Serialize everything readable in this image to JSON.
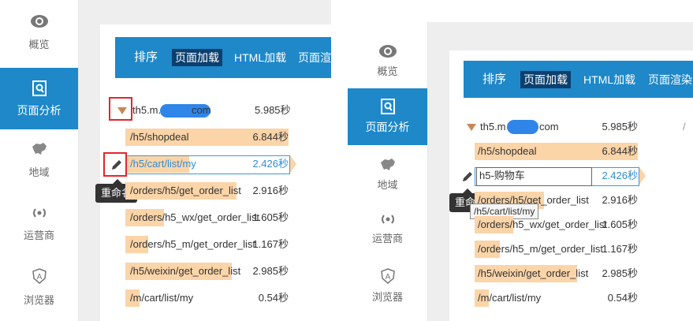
{
  "nav": {
    "overview": "概览",
    "page_analysis": "页面分析",
    "region": "地域",
    "carrier": "运营商",
    "browser": "浏览器"
  },
  "tabs": {
    "sort": "排序",
    "page_load": "页面加载",
    "html_load": "HTML加载",
    "page_render": "页面渲染"
  },
  "colors": {
    "accent": "#1e88c9",
    "active_tab": "#0b3f6e",
    "bar": "#fbd4a8",
    "highlight_time": "#2f8dd6",
    "annotation": "#e3262b"
  },
  "left": {
    "domain": {
      "prefix": "th5.m.",
      "suffix": "com",
      "time": "5.985秒"
    },
    "rows": [
      {
        "path": "/h5/shopdeal",
        "time": "6.844秒"
      },
      {
        "path": "/h5/cart/list/my",
        "time": "2.426秒"
      },
      {
        "path": "/orders/h5/get_order_list",
        "time": "2.916秒"
      },
      {
        "path": "/orders/h5_wx/get_order_list",
        "time": "1.605秒"
      },
      {
        "path": "/orders/h5_m/get_order_list",
        "time": "1.167秒"
      },
      {
        "path": "/h5/weixin/get_order_list",
        "time": "2.985秒"
      },
      {
        "path": "/m/cart/list/my",
        "time": "0.54秒"
      }
    ],
    "tooltip": "重命名"
  },
  "right": {
    "domain": {
      "prefix": "th5.m",
      "suffix": "com",
      "time": "5.985秒"
    },
    "rows": [
      {
        "path": "/h5/shopdeal",
        "time": "6.844秒"
      },
      {
        "path": "h5-购物车",
        "time": "2.426秒"
      },
      {
        "path": "/orders/h5/get_order_list",
        "time": "2.916秒"
      },
      {
        "path": "/orders/h5_wx/get_order_list",
        "time": "1.605秒"
      },
      {
        "path": "/orders/h5_m/get_order_list",
        "time": "1.167秒"
      },
      {
        "path": "/h5/weixin/get_order_list",
        "time": "2.985秒"
      },
      {
        "path": "/m/cart/list/my",
        "time": "0.54秒"
      }
    ],
    "rename_input_value": "h5-购物车",
    "tooltip": "重命名",
    "title_tooltip": "/h5/cart/list/my"
  }
}
